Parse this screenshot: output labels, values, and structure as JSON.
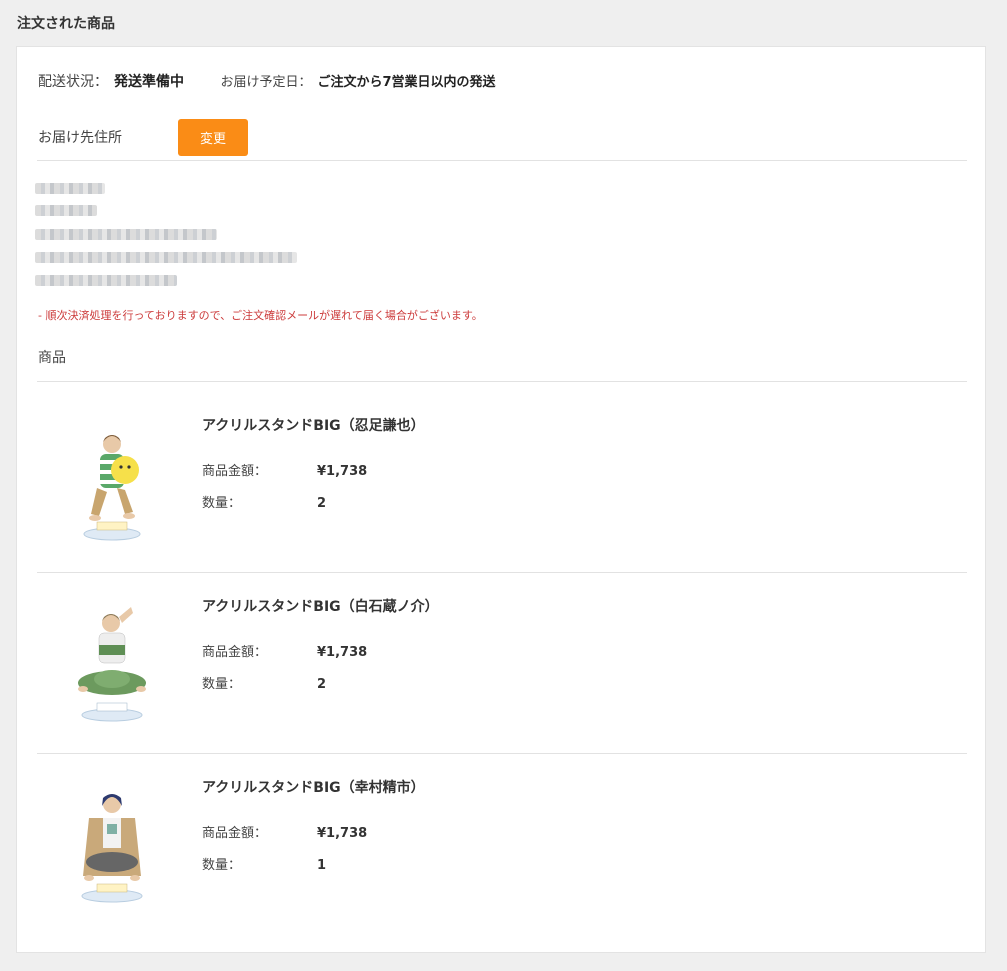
{
  "page": {
    "title": "注文された商品"
  },
  "status": {
    "label": "配送状況：",
    "value": "発送準備中",
    "delivery_label": "お届け予定日：",
    "delivery_value": "ご注文から7営業日以内の発送"
  },
  "address": {
    "label": "お届け先住所",
    "change_button": "変更"
  },
  "notice": "-  順次決済処理を行っておりますので、ご注文確認メールが遅れて届く場合がございます。",
  "products_section": {
    "title": "商品"
  },
  "products": [
    {
      "name": "アクリルスタンドBIG（忍足謙也）",
      "price_label": "商品金額：",
      "price": "¥1,738",
      "qty_label": "数量：",
      "qty": "2",
      "thumb_icon": "acrylic-stand-figure-icon"
    },
    {
      "name": "アクリルスタンドBIG（白石蔵ノ介）",
      "price_label": "商品金額：",
      "price": "¥1,738",
      "qty_label": "数量：",
      "qty": "2",
      "thumb_icon": "acrylic-stand-figure-icon"
    },
    {
      "name": "アクリルスタンドBIG（幸村精市）",
      "price_label": "商品金額：",
      "price": "¥1,738",
      "qty_label": "数量：",
      "qty": "1",
      "thumb_icon": "acrylic-stand-figure-icon"
    }
  ],
  "colors": {
    "accent": "#fa8c16",
    "notice": "#cc3b3b",
    "background": "#efefef"
  }
}
